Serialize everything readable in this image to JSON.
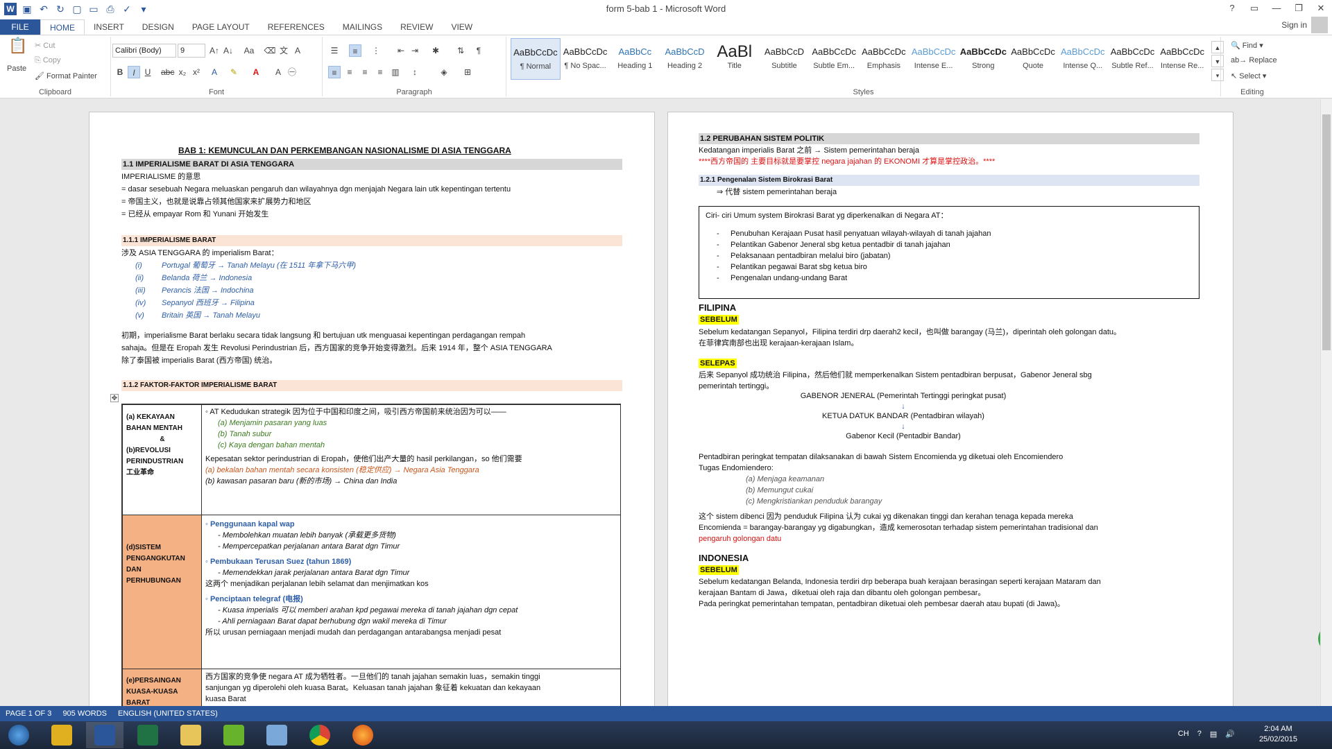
{
  "window": {
    "title": "form 5-bab 1 - Microsoft Word",
    "signin": "Sign in"
  },
  "tabs": [
    "FILE",
    "HOME",
    "INSERT",
    "DESIGN",
    "PAGE LAYOUT",
    "REFERENCES",
    "MAILINGS",
    "REVIEW",
    "VIEW"
  ],
  "ribbon": {
    "clipboard": {
      "label": "Clipboard",
      "paste": "Paste",
      "cut": "Cut",
      "copy": "Copy",
      "format_painter": "Format Painter"
    },
    "font": {
      "label": "Font",
      "family": "Calibri (Body)",
      "size": "9"
    },
    "paragraph": {
      "label": "Paragraph"
    },
    "styles": {
      "label": "Styles",
      "items": [
        {
          "preview": "AaBbCcDc",
          "name": "¶ Normal"
        },
        {
          "preview": "AaBbCcDc",
          "name": "¶ No Spac..."
        },
        {
          "preview": "AaBbCc",
          "name": "Heading 1"
        },
        {
          "preview": "AaBbCcD",
          "name": "Heading 2"
        },
        {
          "preview": "AaBl",
          "name": "Title"
        },
        {
          "preview": "AaBbCcD",
          "name": "Subtitle"
        },
        {
          "preview": "AaBbCcDc",
          "name": "Subtle Em..."
        },
        {
          "preview": "AaBbCcDc",
          "name": "Emphasis"
        },
        {
          "preview": "AaBbCcDc",
          "name": "Intense E..."
        },
        {
          "preview": "AaBbCcDc",
          "name": "Strong"
        },
        {
          "preview": "AaBbCcDc",
          "name": "Quote"
        },
        {
          "preview": "AaBbCcDc",
          "name": "Intense Q..."
        },
        {
          "preview": "AaBbCcDc",
          "name": "Subtle Ref..."
        },
        {
          "preview": "AaBbCcDc",
          "name": "Intense Re..."
        }
      ]
    },
    "editing": {
      "label": "Editing",
      "find": "Find",
      "replace": "Replace",
      "select": "Select"
    }
  },
  "page1": {
    "title": "BAB 1: KEMUNCULAN  DAN  PERKEMBANGAN  NASIONALISME  DI  ASIA  TENGGARA",
    "h11": "1.1    IMPERIALISME  BARAT  DI  ASIA  TENGGARA",
    "l1": "IMPERIALISME 的意思",
    "l2": "= dasar  sesebuah  Negara  meluaskan  pengaruh  dan  wilayahnya  dgn  menjajah  Negara  lain  utk  kepentingan  tertentu",
    "l3": "= 帝国主义，也就是说靠占领其他国家来扩展势力和地区",
    "l4": "= 已经从  empayar Rom  和  Yunani  开始发生",
    "h111": "1.1.1       IMPERIALISME  BARAT",
    "l5": "涉及  ASIA  TENGGARA  的 imperialism  Barat：",
    "list1": [
      {
        "n": "(i)",
        "t": "Portugal 葡萄牙  → Tanah  Melayu  (在 1511 年拿下马六甲)"
      },
      {
        "n": "(ii)",
        "t": "Belanda 荷兰  → Indonesia"
      },
      {
        "n": "(iii)",
        "t": "Perancis 法国  → Indochina"
      },
      {
        "n": "(iv)",
        "t": "Sepanyol 西班牙  → Filipina"
      },
      {
        "n": "(v)",
        "t": "Britain 英国  → Tanah  Melayu"
      }
    ],
    "p1a": "初期，imperialisme  Barat  berlaku  secara  tidak  langsung  和  bertujuan  utk  menguasai  kepentingan  perdagangan  rempah",
    "p1b": "sahaja。但是在 Eropah 发生 Revolusi  Perindustrian 后，西方国家的竞争开始变得激烈。后来 1914 年，整个  ASIA  TENGGARA",
    "p1c": "除了泰国被 imperialis  Barat (西方帝国) 统治。",
    "h112": "1.1.2       FAKTOR-FAKTOR  IMPERIALISME  BARAT",
    "r1left": [
      "(a) KEKAYAAN",
      "BAHAN  MENTAH",
      "&",
      "(b)REVOLUSI",
      "PERINDUSTRIAN",
      "工业革命"
    ],
    "r1": [
      "◦ AT  Kedudukan  strategik 因为位于中国和印度之间，吸引西方帝国前来统治因为可以——",
      "(a)   Menjamin  pasaran  yang  luas",
      "(b)   Tanah  subur",
      "(c)   Kaya  dengan  bahan  mentah",
      "Kepesatan  sektor  perindustrian  di  Eropah，使他们出产大量的 hasil  perkilangan，so 他们需要",
      "(a) bekalan  bahan  mentah  secara  konsisten (稳定供应)  → Negara  Asia  Tenggara",
      "(b) kawasan  pasaran  baru (新的市场)  → China  dan  India"
    ],
    "r2left": [
      "(d)SISTEM",
      "PENGANGKUTAN",
      "DAN",
      "PERHUBUNGAN"
    ],
    "r2": [
      "◦ Penggunaan  kapal wap",
      "-      Membolehkan  muatan  lebih  banyak (承载更多货物)",
      "-      Mempercepatkan  perjalanan  antara  Barat  dgn  Timur",
      "◦ Pembukaan  Terusan  Suez (tahun 1869)",
      "-      Memendekkan  jarak  perjalanan  antara  Barat  dgn  Timur",
      "这两个 menjadikan  perjalanan  lebih   selamat  dan  menjimatkan  kos",
      "◦ Penciptaan  telegraf (电报)",
      "-      Kuasa  imperialis 可以 memberi  arahan  kpd  pegawai  mereka  di  tanah  jajahan  dgn  cepat",
      "-      Ahli  perniagaan  Barat  dapat  berhubung  dgn  wakil  mereka  di  Timur",
      "所以  urusan  perniagaan  menjadi  mudah  dan  perdagangan  antarabangsa  menjadi  pesat"
    ],
    "r3left": [
      "(e)PERSAINGAN",
      "KUASA-KUASA",
      "BARAT"
    ],
    "r3": [
      "西方国家的竞争使 negara AT 成为牺牲者。一旦他们的 tanah  jajahan  semakin  luas，semakin  tinggi",
      "sanjungan  yg  diperolehi  oleh  kuasa  Barat。Keluasan  tanah  jajahan  象征着 kekuatan  dan  kekayaan",
      "kuasa  Barat"
    ]
  },
  "page2": {
    "h12": "1.2    PERUBAHAN  SISTEM  POLITIK",
    "a1": "Kedatangan  imperialis  Barat 之前 → Sistem  pemerintahan  beraja",
    "a2": "****西方帝国的 主要目标就是要掌控 negara  jajahan 的 EKONOMI 才算是掌控政治。****",
    "h121": "1.2.1      Pengenalan  Sistem  Birokrasi  Barat",
    "a3": "⇒   代替  sistem  pemerintahan  beraja",
    "boxtitle": "Ciri- ciri  Umum  system  Birokrasi  Barat  yg  diperkenalkan  di  Negara  AT：",
    "box": [
      "Penubuhan  Kerajaan  Pusat  hasil  penyatuan  wilayah-wilayah  di  tanah  jajahan",
      "Pelantikan  Gabenor  Jeneral  sbg  ketua  pentadbir  di  tanah  jajahan",
      "Pelaksanaan  pentadbiran  melalui  biro (jabatan)",
      "Pelantikan  pegawai  Barat  sbg  ketua  biro",
      "Pengenalan  undang-undang  Barat"
    ],
    "filipina": "FILIPINA",
    "sebelum": "SEBELUM",
    "f1": "Sebelum  kedatangan  Sepanyol，Filipina  terdiri  drp  daerah2  kecil，也叫做 barangay (马兰)，diperintah  oleh  golongan  datu。",
    "f2": "在菲律宾南部也出现 kerajaan-kerajaan  Islam。",
    "selepas": "SELEPAS",
    "f3": "后来 Sepanyol 成功统治 Filipina，然后他们就 memperkenalkan  Sistem  pentadbiran  berpusat，Gabenor  Jeneral  sbg",
    "f4": "pemerintah  tertinggi。",
    "c1": "GABENOR  JENERAL (Pemerintah  Tertinggi peringkat  pusat)",
    "c2": "KETUA  DATUK  BANDAR (Pentadbiran  wilayah)",
    "c3": "Gabenor  Kecil  (Pentadbir  Bandar)",
    "f5": "Pentadbiran  peringkat  tempatan  dilaksanakan  di  bawah  Sistem  Encomienda  yg  diketuai  oleh  Encomiendero",
    "f6": "Tugas  Endomiendero:",
    "tug": [
      "(a)    Menjaga  keamanan",
      "(b)    Memungut  cukai",
      "(c)    Mengkristiankan  penduduk  barangay"
    ],
    "f7": "这个 sistem  dibenci 因为 penduduk  Filipina 认为 cukai  yg  dikenakan  tinggi  dan  kerahan  tenaga kepada  mereka",
    "f8": "Encomienda =  barangay-barangay yg  digabungkan，造成 kemerosotan  terhadap  sistem  pemerintahan  tradisional  dan",
    "f9": "pengaruh  golongan  datu",
    "indonesia": "INDONESIA",
    "i1": "Sebelum  kedatangan  Belanda, Indonesia  terdiri  drp  beberapa  buah  kerajaan  berasingan  seperti  kerajaan  Mataram  dan",
    "i2": "kerajaan  Bantam  di  Jawa，diketuai  oleh  raja  dan  dibantu  oleh  golongan  pembesar。",
    "i3": "Pada  peringkat  pemerintahan  tempatan, pentadbiran  diketuai  oleh  pembesar  daerah  atau  bupati (di Jawa)。"
  },
  "status": {
    "page": "PAGE 1 OF 3",
    "words": "905 WORDS",
    "lang": "ENGLISH (UNITED STATES)"
  },
  "taskbar": {
    "time": "2:04 AM",
    "date": "25/02/2015",
    "lang": "CH"
  },
  "colors": {
    "accent": "#2b579a",
    "shade_gray": "#d6d6d6",
    "shade_orange": "#fbe3d5",
    "shade_blue": "#dde5f3",
    "table_orange": "#f4b184",
    "yellow": "#ffff00"
  }
}
